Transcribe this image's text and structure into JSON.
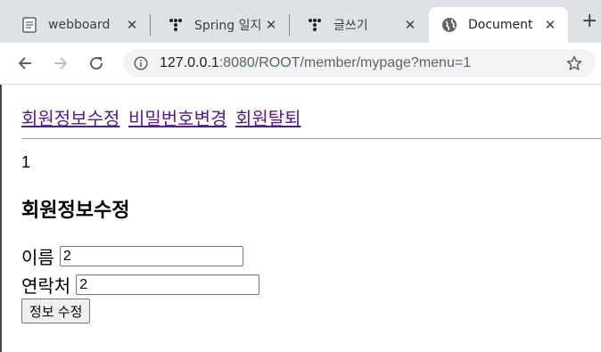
{
  "browser": {
    "tabs": [
      {
        "title": "webboard",
        "icon": "document-icon"
      },
      {
        "title": "Spring 일지",
        "icon": "dots-logo-icon"
      },
      {
        "title": "글쓰기",
        "icon": "dots-logo-icon"
      },
      {
        "title": "Document",
        "icon": "globe-icon",
        "active": true
      }
    ],
    "new_tab": "+",
    "url_host": "127.0.0.1",
    "url_rest": ":8080/ROOT/member/mypage?menu=1"
  },
  "page": {
    "menu_links": [
      "회원정보수정",
      "비밀번호변경",
      "회원탈퇴"
    ],
    "menu_value": "1",
    "heading": "회원정보수정",
    "form": {
      "name_label": "이름",
      "name_value": "2",
      "phone_label": "연락처",
      "phone_value": "2",
      "submit_label": "정보 수정"
    }
  },
  "colors": {
    "tabstrip": "#dee1e6",
    "link_visited": "#551a8b",
    "omnibox": "#f1f3f4"
  }
}
